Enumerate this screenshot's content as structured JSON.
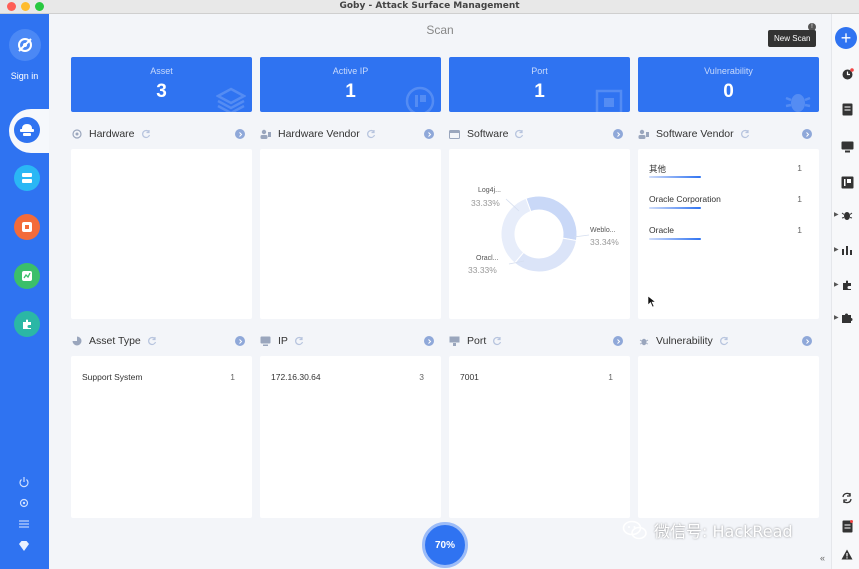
{
  "window": {
    "title": "Goby - Attack Surface Management"
  },
  "sidebar": {
    "signin_label": "Sign in"
  },
  "page": {
    "title": "Scan"
  },
  "stats": [
    {
      "label": "Asset",
      "value": "3"
    },
    {
      "label": "Active IP",
      "value": "1"
    },
    {
      "label": "Port",
      "value": "1"
    },
    {
      "label": "Vulnerability",
      "value": "0"
    }
  ],
  "panels": {
    "hardware": {
      "title": "Hardware"
    },
    "hardware_vendor": {
      "title": "Hardware Vendor"
    },
    "software": {
      "title": "Software",
      "chart_data": {
        "type": "pie",
        "categories": [
          "Log4j...",
          "Weblo...",
          "Oracl..."
        ],
        "values": [
          33.33,
          33.34,
          33.33
        ],
        "labels": [
          "33.33%",
          "33.34%",
          "33.33%"
        ],
        "colors": [
          "#c9d8f7",
          "#dbe4f8",
          "#e7edfa"
        ]
      }
    },
    "software_vendor": {
      "title": "Software Vendor",
      "items": [
        {
          "name": "其他",
          "count": "1"
        },
        {
          "name": "Oracle Corporation",
          "count": "1"
        },
        {
          "name": "Oracle",
          "count": "1"
        }
      ]
    },
    "asset_type": {
      "title": "Asset Type",
      "items": [
        {
          "name": "Support System",
          "count": "1"
        }
      ]
    },
    "ip": {
      "title": "IP",
      "items": [
        {
          "name": "172.16.30.64",
          "count": "3"
        }
      ]
    },
    "port": {
      "title": "Port",
      "items": [
        {
          "name": "7001",
          "count": "1"
        }
      ]
    },
    "vulnerability": {
      "title": "Vulnerability"
    }
  },
  "progress": {
    "label": "70%",
    "value": 70
  },
  "tooltip": {
    "new_scan": "New Scan"
  },
  "watermark": {
    "text": "微信号: HackRead"
  },
  "colors": {
    "primary": "#2f73f1",
    "sidebar": "#2f73f1",
    "background": "#f3f5f9"
  }
}
